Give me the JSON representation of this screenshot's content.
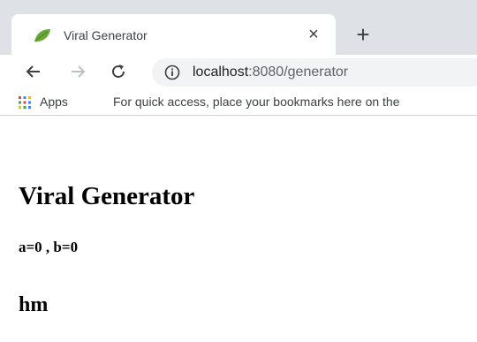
{
  "browser": {
    "tab": {
      "title": "Viral Generator",
      "close_symbol": "×",
      "favicon": "leaf-icon"
    },
    "new_tab_symbol": "+",
    "nav": {
      "back": "←",
      "forward": "→",
      "reload": "C"
    },
    "address": {
      "host": "localhost",
      "rest": ":8080/generator"
    },
    "bookmarks": {
      "apps_label": "Apps",
      "hint": "For quick access, place your bookmarks here on the"
    }
  },
  "page": {
    "title": "Viral Generator",
    "values_line": "a=0 , b=0",
    "subheading": "hm"
  }
}
